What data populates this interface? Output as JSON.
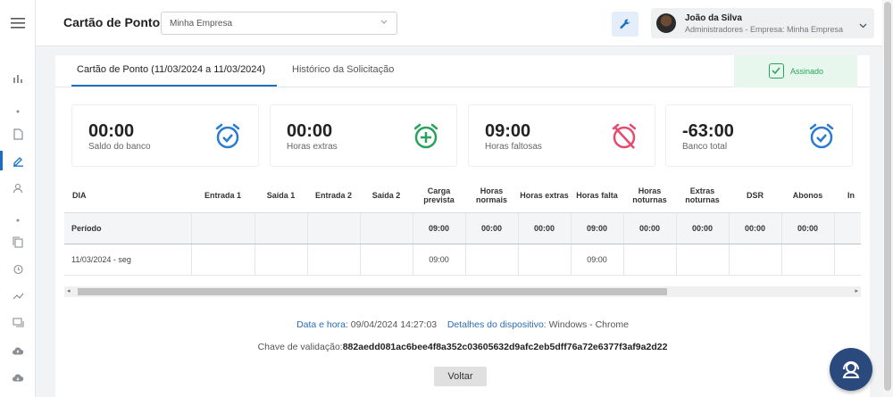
{
  "header": {
    "title": "Cartão de Ponto",
    "company_select": "Minha Empresa",
    "user": {
      "name": "João da Silva",
      "role": "Administradores - Empresa: Minha Empresa"
    }
  },
  "tabs": [
    {
      "label": "Cartão de Ponto (11/03/2024 a 11/03/2024)",
      "active": true
    },
    {
      "label": "Histórico da Solicitação",
      "active": false
    }
  ],
  "signed_label": "Assinado",
  "cards": [
    {
      "value": "00:00",
      "label": "Saldo do banco",
      "icon": "alarm-check-icon",
      "color": "#2b7bd0"
    },
    {
      "value": "00:00",
      "label": "Horas extras",
      "icon": "alarm-plus-icon",
      "color": "#27a35a"
    },
    {
      "value": "09:00",
      "label": "Horas faltosas",
      "icon": "alarm-off-icon",
      "color": "#e64a6f"
    },
    {
      "value": "-63:00",
      "label": "Banco total",
      "icon": "alarm-check-icon",
      "color": "#2b7bd0"
    }
  ],
  "table": {
    "headers": [
      "DIA",
      "Entrada 1",
      "Saída 1",
      "Entrada 2",
      "Saída 2",
      "Carga prevista",
      "Horas normais",
      "Horas extras",
      "Horas falta",
      "Horas noturnas",
      "Extras noturnas",
      "DSR",
      "Abonos",
      "In"
    ],
    "rows": [
      [
        "Período",
        "",
        "",
        "",
        "",
        "09:00",
        "00:00",
        "00:00",
        "09:00",
        "00:00",
        "00:00",
        "00:00",
        "00:00",
        ""
      ],
      [
        "11/03/2024 - seg",
        "",
        "",
        "",
        "",
        "09:00",
        "",
        "",
        "09:00",
        "",
        "",
        "",
        "",
        ""
      ]
    ]
  },
  "footer": {
    "datetime_label": "Data e hora:",
    "datetime_value": "09/04/2024 14:27:03",
    "device_label": "Detalhes do dispositivo:",
    "device_value": "Windows - Chrome",
    "key_label": "Chave de validação:",
    "key_value": "882aedd081ac6bee4f8a352c03605632d9afc2eb5dff76a72e6377f3af9a2d22",
    "back_label": "Voltar"
  },
  "colors": {
    "accent": "#1a6fc4",
    "success": "#27a35a",
    "danger": "#e64a6f"
  }
}
